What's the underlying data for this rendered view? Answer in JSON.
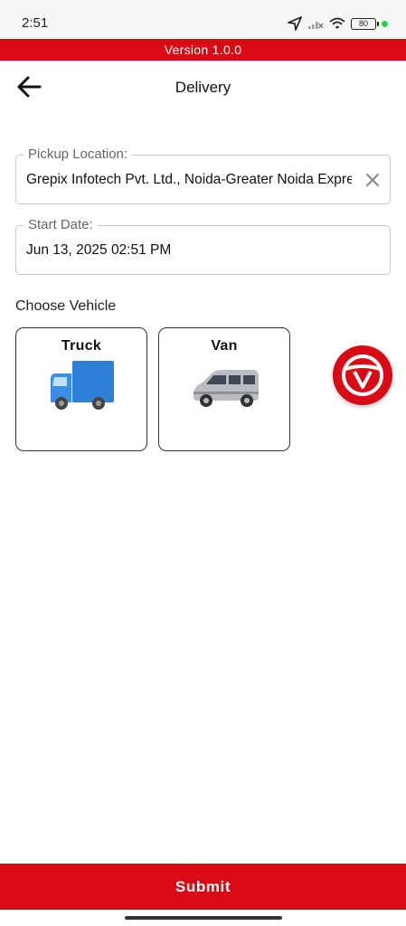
{
  "status_bar": {
    "time": "2:51",
    "battery": "80",
    "icons": [
      "location-arrow-icon",
      "signal-off-icon",
      "wifi-icon",
      "battery-icon",
      "green-dot-icon"
    ],
    "dot_color": "#2ecc50"
  },
  "banner": {
    "version_text": "Version 1.0.0",
    "color": "#d90a16"
  },
  "header": {
    "title": "Delivery",
    "back_icon": "arrow-left-icon"
  },
  "form": {
    "pickup": {
      "label": "Pickup Location:",
      "value": "Grepix Infotech Pvt. Ltd., Noida-Greater Noida Expressway",
      "clear_icon": "close-icon"
    },
    "start_date": {
      "label": "Start Date:",
      "value": "Jun 13, 2025 02:51 PM"
    }
  },
  "vehicles": {
    "section_label": "Choose Vehicle",
    "items": [
      {
        "name": "Truck",
        "icon": "truck-icon"
      },
      {
        "name": "Van",
        "icon": "van-icon"
      }
    ]
  },
  "fab": {
    "icon": "steering-wheel-icon"
  },
  "footer": {
    "submit_label": "Submit"
  },
  "colors": {
    "primary": "#d90a16",
    "border": "#c8c8c8"
  }
}
